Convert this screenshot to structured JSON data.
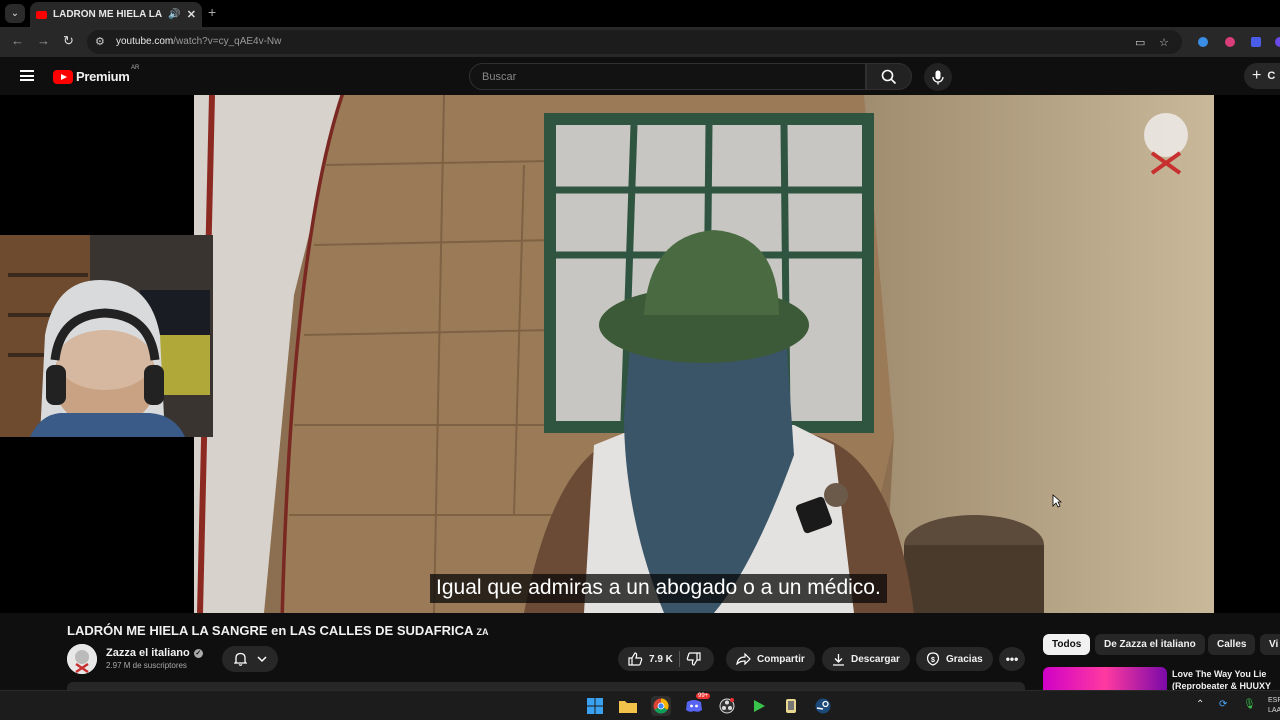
{
  "browser": {
    "tab_title": "LADRÓN ME HIELA LA SANGRE",
    "tab_close": "✕",
    "new_tab": "+",
    "url_host": "youtube.com",
    "url_path": "/watch?v=cy_qAE4v-Nw"
  },
  "header": {
    "logo_text": "Premium",
    "region": "AR",
    "search_placeholder": "Buscar",
    "create_label": "C"
  },
  "player": {
    "subtitle": "Igual que admiras a un abogado o a un médico."
  },
  "video": {
    "title": "LADRÓN ME HIELA LA SANGRE en LAS CALLES DE SUDAFRICA ",
    "title_suffix": "ZA",
    "channel_name": "Zazza el italiano",
    "subscribers": "2.97 M de suscriptores",
    "likes": "7.9 K",
    "share_label": "Compartir",
    "download_label": "Descargar",
    "thanks_label": "Gracias",
    "more_label": "•••"
  },
  "sidebar": {
    "chips": [
      "Todos",
      "De Zazza el italiano",
      "Calles",
      "Vi"
    ],
    "recommendation_title_line1": "Love The Way You Lie",
    "recommendation_title_line2": "(Reprobeater & HUUXY"
  },
  "taskbar": {
    "lang_line1": "ESP",
    "lang_line2": "LAA",
    "discord_badge": "99+"
  },
  "colors": {
    "youtube_red": "#ff0000",
    "background": "#0f0f0f",
    "pill": "#272727"
  }
}
